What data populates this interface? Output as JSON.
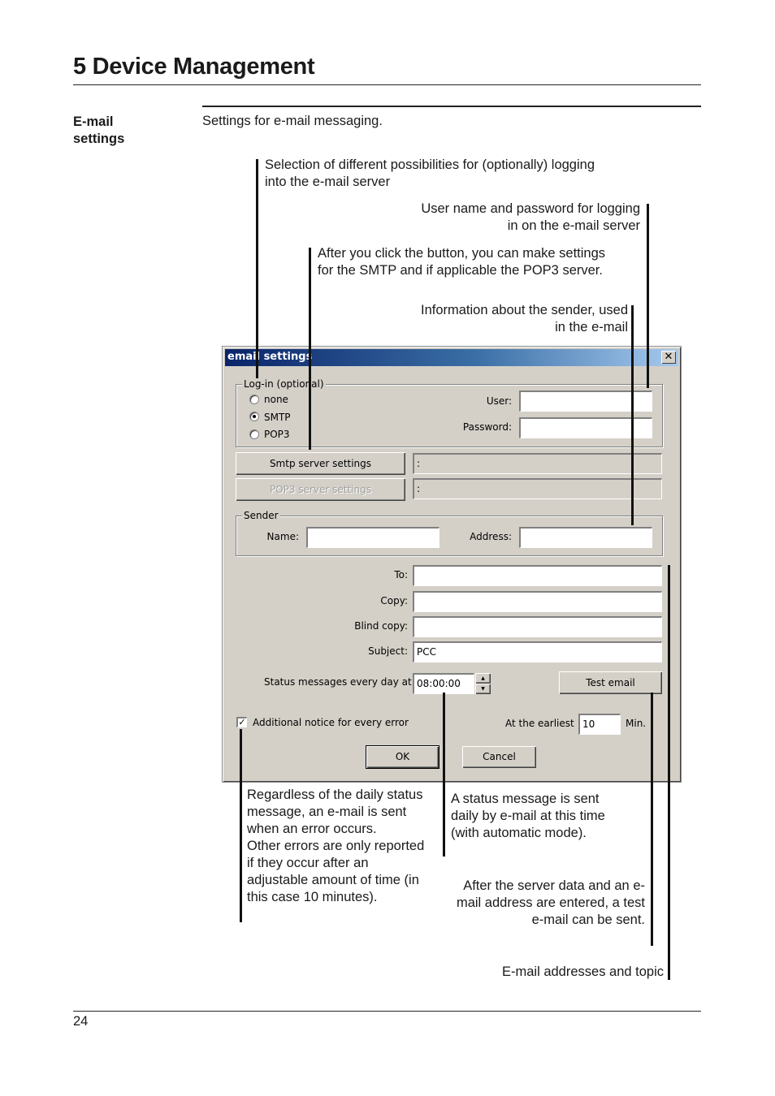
{
  "header": {
    "chapter_title": "5 Device Management"
  },
  "section": {
    "heading_line1": "E-mail",
    "heading_line2": "settings",
    "intro": "Settings for e-mail messaging."
  },
  "callouts": {
    "login_selection": [
      "Selection of different possibilities for (optionally) logging",
      "into the e-mail server"
    ],
    "user_password": [
      "User name and password for logging",
      "in on the e-mail server"
    ],
    "smtp_button": [
      "After you click the button, you can make settings",
      "for the SMTP and if applicable the POP3 server."
    ],
    "sender_info": [
      "Information about the sender, used",
      "in the e-mail"
    ],
    "error_notice": [
      "Regardless of the daily status",
      "message, an e-mail is sent",
      "when an error occurs.",
      "Other errors are only reported",
      "if they occur after an",
      "adjustable amount of time (in",
      "this case 10 minutes)."
    ],
    "status_time": [
      "A status message is sent",
      "daily by e-mail at this time",
      "(with automatic mode)."
    ],
    "test_email": [
      "After the server data and an e-",
      "mail address are entered, a test",
      "e-mail can be sent."
    ],
    "addresses_topic": "E-mail addresses and topic"
  },
  "dialog": {
    "title": "email settings",
    "close_symbol": "✕",
    "login_group": {
      "legend": "Log-in (optional)",
      "options": [
        {
          "label": "none",
          "selected": false
        },
        {
          "label": "SMTP",
          "selected": true
        },
        {
          "label": "POP3",
          "selected": false
        }
      ],
      "user_label": "User:",
      "user_value": "",
      "password_label": "Password:",
      "password_value": ""
    },
    "smtp_button": "Smtp server settings",
    "smtp_status": ":",
    "pop3_button": "POP3 server settings",
    "pop3_status": ":",
    "sender_group": {
      "legend": "Sender",
      "name_label": "Name:",
      "name_value": "",
      "address_label": "Address:",
      "address_value": ""
    },
    "to_label": "To:",
    "to_value": "",
    "copy_label": "Copy:",
    "copy_value": "",
    "blind_copy_label": "Blind copy:",
    "blind_copy_value": "",
    "subject_label": "Subject:",
    "subject_value": "PCC",
    "status_label": "Status messages every day at",
    "status_time": "08:00:00",
    "spin_up": "▲",
    "spin_down": "▼",
    "test_button": "Test email",
    "error_checkbox_label": "Additional notice for every error",
    "error_checked": true,
    "check_symbol": "✓",
    "earliest_label": "At the earliest",
    "earliest_value": "10",
    "earliest_unit": "Min.",
    "ok_button": "OK",
    "cancel_button": "Cancel"
  },
  "footer": {
    "page_number": "24"
  }
}
